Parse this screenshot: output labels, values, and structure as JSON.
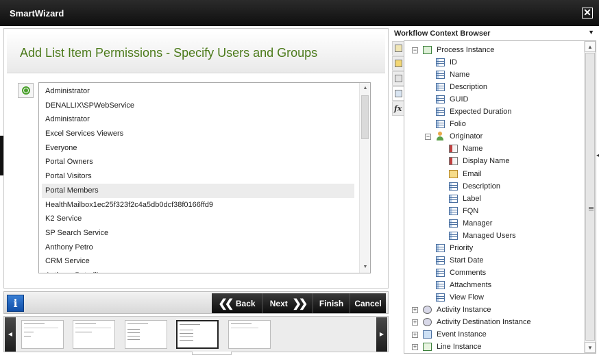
{
  "window": {
    "title": "SmartWizard",
    "close_glyph": "✕"
  },
  "wizard": {
    "heading": "Add List Item Permissions - Specify Users and Groups",
    "users": [
      "Administrator",
      "DENALLIX\\SPWebService",
      "Administrator",
      "Excel Services Viewers",
      "Everyone",
      "Portal Owners",
      "Portal Visitors",
      "Portal Members",
      "HealthMailbox1ec25f323f2c4a5db0dcf38f0166ffd9",
      "K2 Service",
      "SP Search Service",
      "Anthony Petro",
      "CRM Service",
      "Anthony Petrelli"
    ],
    "selected_user": "Portal Members"
  },
  "buttons": {
    "info": "i",
    "back": "Back",
    "next": "Next",
    "finish": "Finish",
    "cancel": "Cancel"
  },
  "context_browser": {
    "title": "Workflow Context Browser",
    "tree": [
      {
        "label": "Process Instance",
        "icon": "process-icon",
        "expander": "−"
      },
      {
        "label": "ID",
        "icon": "field-icon"
      },
      {
        "label": "Name",
        "icon": "field-icon"
      },
      {
        "label": "Description",
        "icon": "field-icon"
      },
      {
        "label": "GUID",
        "icon": "field-icon"
      },
      {
        "label": "Expected Duration",
        "icon": "field-icon"
      },
      {
        "label": "Folio",
        "icon": "field-icon"
      },
      {
        "label": "Originator",
        "icon": "user-icon",
        "expander": "−"
      },
      {
        "label": "Name",
        "icon": "card-icon"
      },
      {
        "label": "Display Name",
        "icon": "card-icon"
      },
      {
        "label": "Email",
        "icon": "mail-icon"
      },
      {
        "label": "Description",
        "icon": "field-icon"
      },
      {
        "label": "Label",
        "icon": "field-icon"
      },
      {
        "label": "FQN",
        "icon": "field-icon"
      },
      {
        "label": "Manager",
        "icon": "field-icon"
      },
      {
        "label": "Managed Users",
        "icon": "field-icon"
      },
      {
        "label": "Priority",
        "icon": "field-icon"
      },
      {
        "label": "Start Date",
        "icon": "field-icon"
      },
      {
        "label": "Comments",
        "icon": "field-icon"
      },
      {
        "label": "Attachments",
        "icon": "field-icon"
      },
      {
        "label": "View Flow",
        "icon": "field-icon"
      },
      {
        "label": "Activity Instance",
        "icon": "gear-icon",
        "expander": "+"
      },
      {
        "label": "Activity Destination Instance",
        "icon": "gear-icon",
        "expander": "+"
      },
      {
        "label": "Event Instance",
        "icon": "event-icon",
        "expander": "+"
      },
      {
        "label": "Line Instance",
        "icon": "line-icon",
        "expander": "+"
      }
    ]
  }
}
